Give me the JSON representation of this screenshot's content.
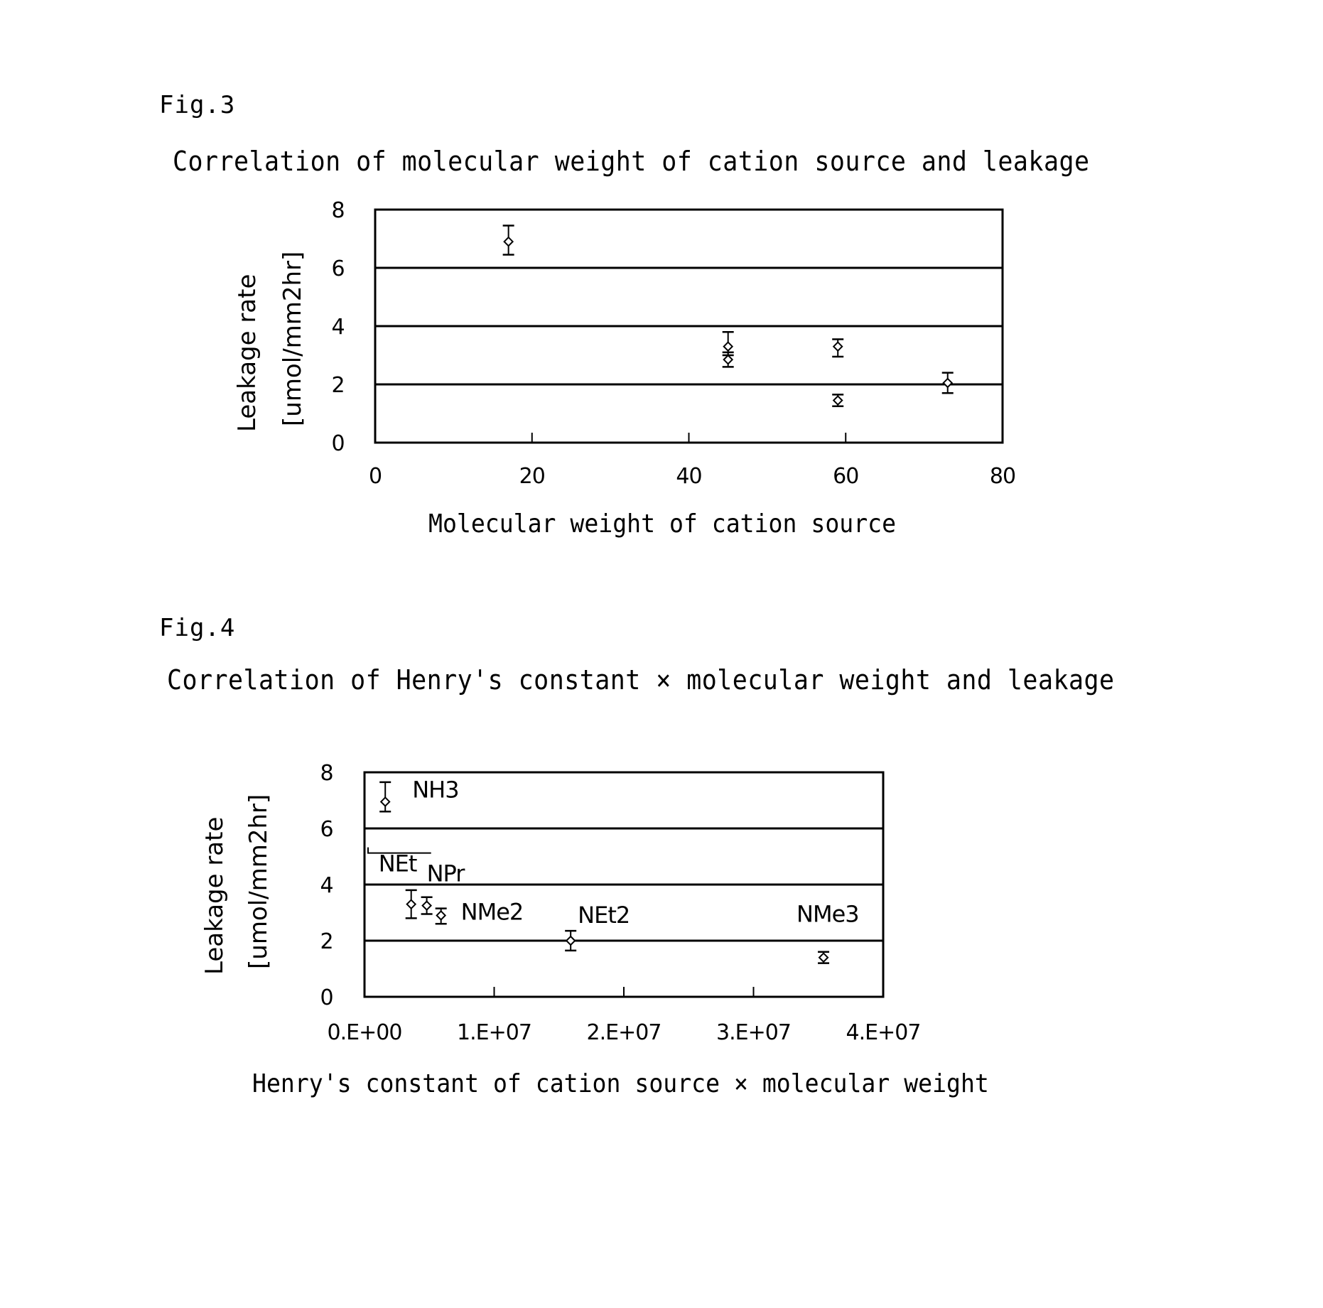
{
  "figures": [
    {
      "label": "Fig.3",
      "title": "Correlation of molecular weight of cation source and leakage"
    },
    {
      "label": "Fig.4",
      "title": "Correlation of Henry's constant × molecular weight and leakage"
    }
  ],
  "chart_data": [
    {
      "type": "scatter",
      "title": "Correlation of molecular weight of cation source and leakage",
      "xlabel": "Molecular weight of cation source",
      "ylabel": [
        "Leakage rate",
        "[umol/mm2hr]"
      ],
      "xlim": [
        0,
        80
      ],
      "ylim": [
        0,
        8
      ],
      "xticks": [
        0,
        20,
        40,
        60,
        80
      ],
      "xtick_labels": [
        "0",
        "20",
        "40",
        "60",
        "80"
      ],
      "yticks": [
        0,
        2,
        4,
        6,
        8
      ],
      "ytick_labels": [
        "0",
        "2",
        "4",
        "6",
        "8"
      ],
      "grid": "horizontal",
      "legend": "none",
      "marker": "diamond",
      "points": [
        {
          "x": 17,
          "y": 6.9,
          "err_low": 6.45,
          "err_high": 7.45
        },
        {
          "x": 45,
          "y": 3.3,
          "err_low": 3.0,
          "err_high": 3.8
        },
        {
          "x": 45,
          "y": 2.85,
          "err_low": 2.6,
          "err_high": 3.1
        },
        {
          "x": 59,
          "y": 3.3,
          "err_low": 2.95,
          "err_high": 3.55
        },
        {
          "x": 59,
          "y": 1.45,
          "err_low": 1.25,
          "err_high": 1.65
        },
        {
          "x": 73,
          "y": 2.05,
          "err_low": 1.7,
          "err_high": 2.4
        }
      ]
    },
    {
      "type": "scatter",
      "title": "Correlation of Henry's constant × molecular weight and leakage",
      "xlabel": "Henry's constant of cation source × molecular weight",
      "ylabel": [
        "Leakage rate",
        "[umol/mm2hr]"
      ],
      "xlim": [
        0,
        40000000
      ],
      "ylim": [
        0,
        8
      ],
      "xticks": [
        0,
        10000000,
        20000000,
        30000000,
        40000000
      ],
      "xtick_labels": [
        "0.E+00",
        "1.E+07",
        "2.E+07",
        "3.E+07",
        "4.E+07"
      ],
      "yticks": [
        0,
        2,
        4,
        6,
        8
      ],
      "ytick_labels": [
        "0",
        "2",
        "4",
        "6",
        "8"
      ],
      "grid": "horizontal",
      "legend": "none",
      "marker": "diamond",
      "points": [
        {
          "label": "NH3",
          "x": 1600000,
          "y": 6.95,
          "err_low": 6.6,
          "err_high": 7.65
        },
        {
          "label": "NEt",
          "x": 3600000,
          "y": 3.3,
          "err_low": 2.8,
          "err_high": 3.8
        },
        {
          "label": "NPr",
          "x": 4800000,
          "y": 3.25,
          "err_low": 2.95,
          "err_high": 3.55
        },
        {
          "label": "NMe2",
          "x": 5900000,
          "y": 2.9,
          "err_low": 2.6,
          "err_high": 3.15
        },
        {
          "label": "NEt2",
          "x": 15900000,
          "y": 2.0,
          "err_low": 1.65,
          "err_high": 2.35
        },
        {
          "label": "NMe3",
          "x": 35400000,
          "y": 1.4,
          "err_low": 1.2,
          "err_high": 1.6
        }
      ]
    }
  ]
}
